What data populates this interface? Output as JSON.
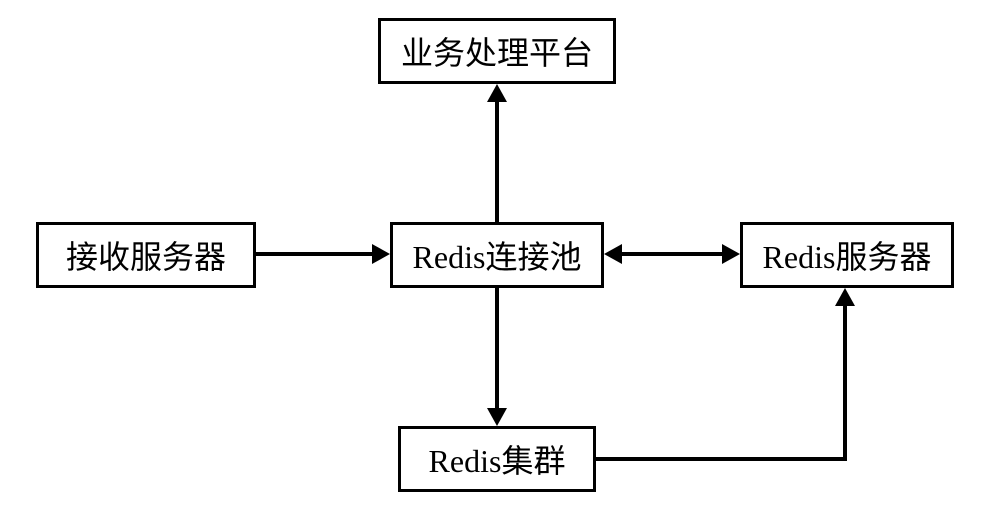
{
  "nodes": {
    "business_platform": "业务处理平台",
    "receiving_server": "接收服务器",
    "redis_pool": "Redis连接池",
    "redis_server": "Redis服务器",
    "redis_cluster": "Redis集群"
  },
  "edges": [
    {
      "from": "receiving_server",
      "to": "redis_pool",
      "bidirectional": false
    },
    {
      "from": "redis_pool",
      "to": "business_platform",
      "bidirectional": false
    },
    {
      "from": "redis_pool",
      "to": "redis_server",
      "bidirectional": true
    },
    {
      "from": "redis_pool",
      "to": "redis_cluster",
      "bidirectional": false
    },
    {
      "from": "redis_cluster",
      "to": "redis_server",
      "bidirectional": false
    }
  ]
}
